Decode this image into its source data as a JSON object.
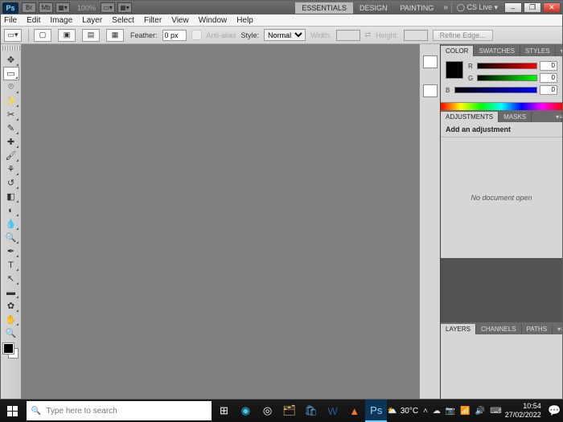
{
  "titlebar": {
    "logo": "Ps",
    "mb": "Mb",
    "br": "Br",
    "zoom": "100%",
    "workspaces": [
      "ESSENTIALS",
      "DESIGN",
      "PAINTING"
    ],
    "cslive": "CS Live"
  },
  "menu": [
    "File",
    "Edit",
    "Image",
    "Layer",
    "Select",
    "Filter",
    "View",
    "Window",
    "Help"
  ],
  "options": {
    "feather_label": "Feather:",
    "feather_value": "0 px",
    "antialias": "Anti-alias",
    "style_label": "Style:",
    "style_value": "Normal",
    "width_label": "Width:",
    "height_label": "Height:",
    "refine": "Refine Edge..."
  },
  "color": {
    "tab1": "COLOR",
    "tab2": "SWATCHES",
    "tab3": "STYLES",
    "r_label": "R",
    "g_label": "G",
    "b_label": "B",
    "r": "0",
    "g": "0",
    "b": "0"
  },
  "adjustments": {
    "tab1": "ADJUSTMENTS",
    "tab2": "MASKS",
    "heading": "Add an adjustment",
    "empty": "No document open"
  },
  "layers": {
    "tab1": "LAYERS",
    "tab2": "CHANNELS",
    "tab3": "PATHS"
  },
  "taskbar": {
    "search_placeholder": "Type here to search",
    "temp": "30°C",
    "time": "10:54",
    "date": "27/02/2022"
  }
}
